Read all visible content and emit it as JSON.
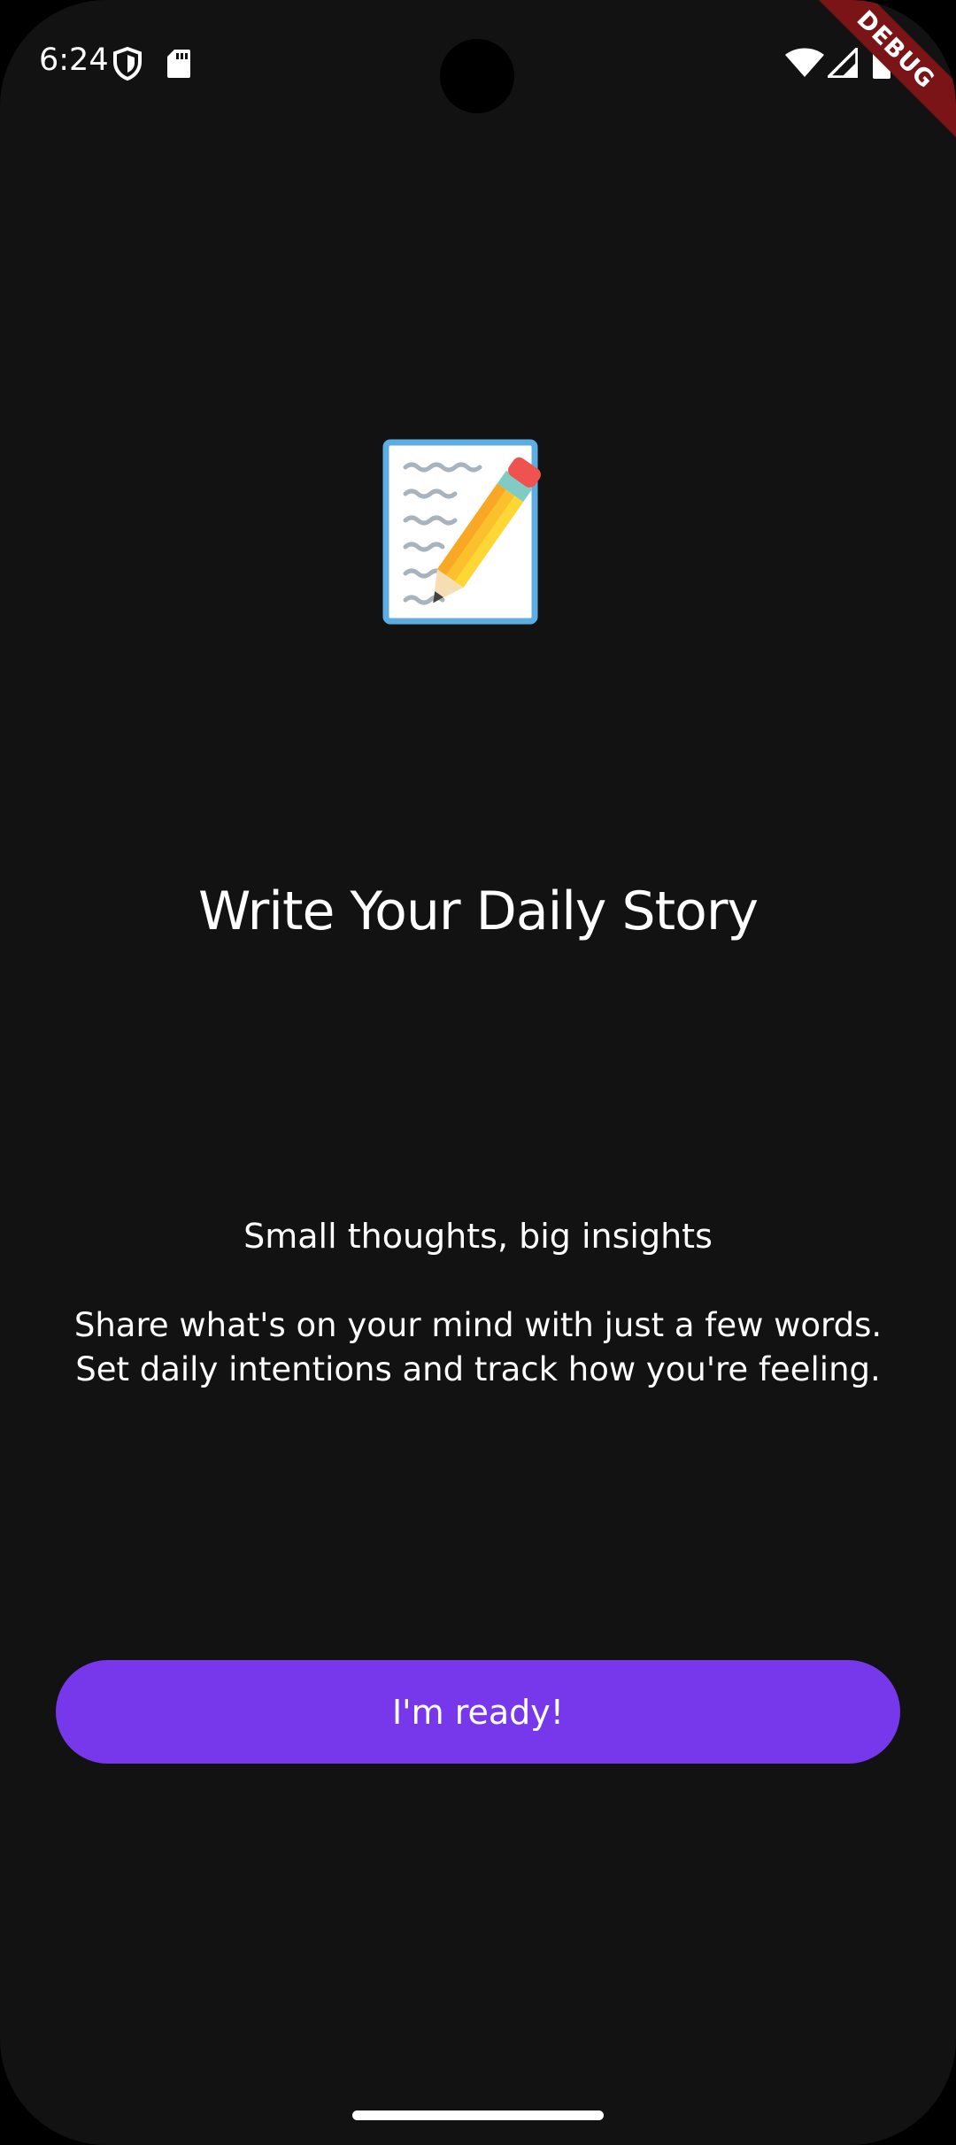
{
  "status_bar": {
    "time": "6:24",
    "icons": [
      "shield-icon",
      "sd-card-icon",
      "wifi-icon",
      "signal-icon",
      "battery-icon"
    ]
  },
  "debug_banner": "DEBUG",
  "onboarding": {
    "icon": "memo-pencil-icon",
    "title": "Write Your Daily Story",
    "subtitle": "Small thoughts, big insights",
    "description_lines": [
      "Share what's on your mind with just a few words.",
      "Set daily intentions and track how you're feeling."
    ],
    "button_label": "I'm ready!"
  },
  "colors": {
    "background": "#121212",
    "accent": "#7638ea",
    "text": "#ffffff",
    "debug_ribbon": "#7a1416"
  }
}
